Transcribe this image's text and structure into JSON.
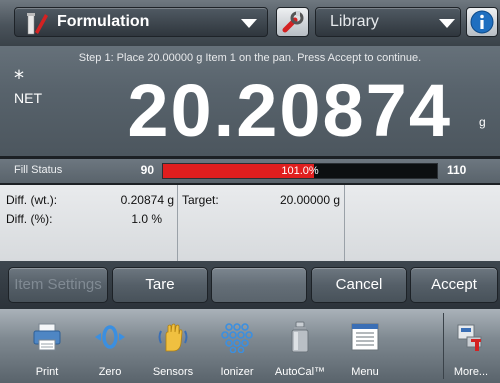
{
  "topbar": {
    "app_name": "Formulation",
    "library_label": "Library"
  },
  "display": {
    "instruction": "Step 1: Place 20.00000 g Item 1 on the pan. Press Accept to continue.",
    "stable_symbol": "*",
    "mode_label": "NET",
    "weight": "20.20874",
    "unit": "g"
  },
  "fill_status": {
    "label": "Fill Status",
    "min": "90",
    "max": "110",
    "percent_text": "101.0%",
    "percent_value": 101.0
  },
  "info": {
    "diff_wt_label": "Diff. (wt.):",
    "diff_wt_value": "0.20874 g",
    "diff_pct_label": "Diff. (%):",
    "diff_pct_value": "1.0 %",
    "target_label": "Target:",
    "target_value": "20.00000 g"
  },
  "softkeys": {
    "item_settings": "Item Settings",
    "tare": "Tare",
    "cancel": "Cancel",
    "accept": "Accept"
  },
  "dock": {
    "items": [
      {
        "label": "Print",
        "icon": "printer-icon"
      },
      {
        "label": "Zero",
        "icon": "zero-icon"
      },
      {
        "label": "Sensors",
        "icon": "sensors-hand-icon"
      },
      {
        "label": "Ionizer",
        "icon": "ionizer-icon"
      },
      {
        "label": "AutoCal™",
        "icon": "calibration-weight-icon"
      },
      {
        "label": "Menu",
        "icon": "menu-list-icon"
      },
      {
        "label": "More...",
        "icon": "more-icon"
      }
    ]
  },
  "colors": {
    "fill_bar": "#e01e1e",
    "display_bg": "#58636c"
  }
}
